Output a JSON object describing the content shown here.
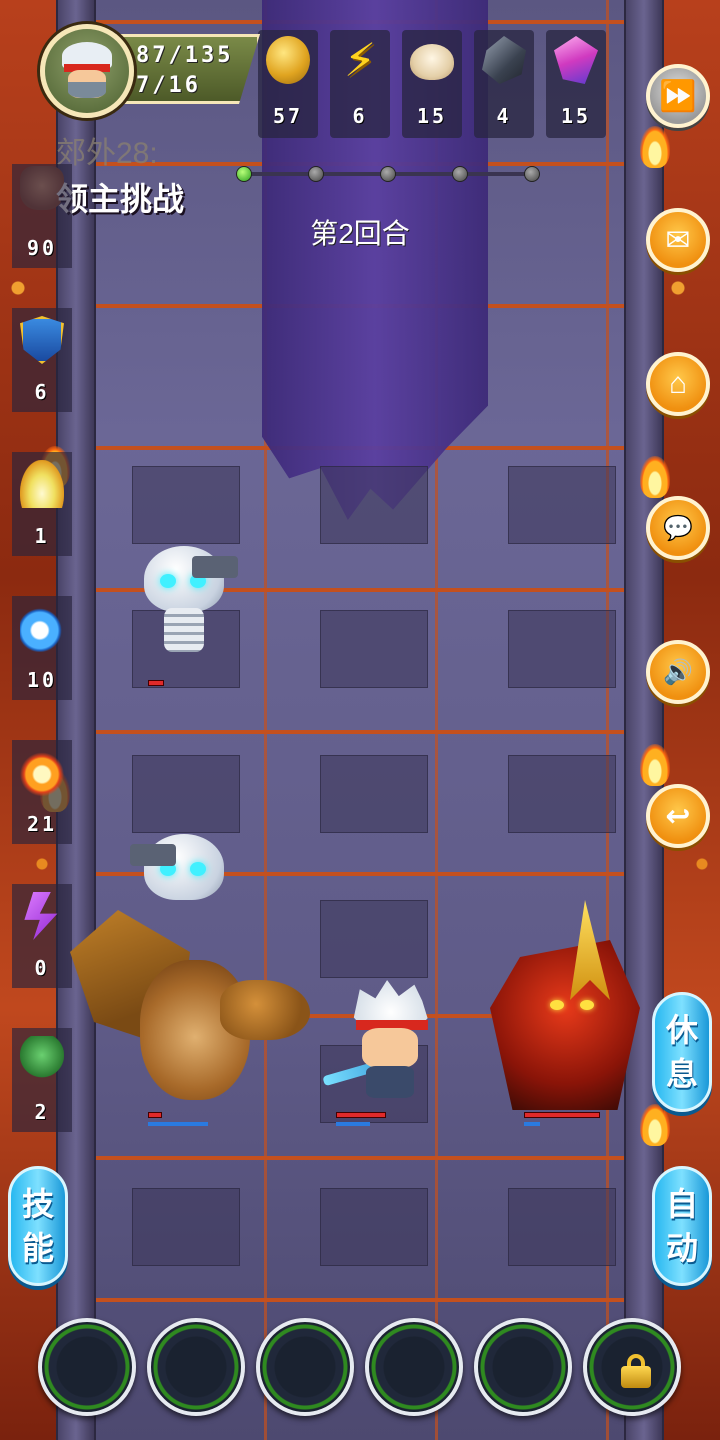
{
  "player": {
    "hp": "87/135",
    "level_progress": "7/16"
  },
  "resources": [
    {
      "icon": "coin-icon",
      "value": "57"
    },
    {
      "icon": "energy-bolt-icon",
      "value": "6"
    },
    {
      "icon": "bun-icon",
      "value": "15"
    },
    {
      "icon": "ore-icon",
      "value": "4"
    },
    {
      "icon": "crystal-icon",
      "value": "15"
    }
  ],
  "stage": {
    "label": "郊外28:",
    "title": "领主挑战",
    "round": "第2回合",
    "progress_total_steps": 5,
    "progress_current_step": 1
  },
  "skills_column": [
    {
      "icon": "fist-icon",
      "value": "90"
    },
    {
      "icon": "shield-icon",
      "value": "6"
    },
    {
      "icon": "holy-flame-icon",
      "value": "1"
    },
    {
      "icon": "water-swirl-icon",
      "value": "10"
    },
    {
      "icon": "fire-burst-icon",
      "value": "21"
    },
    {
      "icon": "lightning-rune-icon",
      "value": "0"
    },
    {
      "icon": "wind-icon",
      "value": "2"
    }
  ],
  "right_menu": [
    {
      "icon": "fast-forward-icon",
      "glyph": "⏩"
    },
    {
      "icon": "mail-icon",
      "glyph": "✉"
    },
    {
      "icon": "home-icon",
      "glyph": "⌂"
    },
    {
      "icon": "chat-icon",
      "glyph": "💬"
    },
    {
      "icon": "sound-icon",
      "glyph": "🔊"
    },
    {
      "icon": "return-icon",
      "glyph": "↩"
    }
  ],
  "buttons": {
    "rest": [
      "休",
      "息"
    ],
    "skills": [
      "技",
      "能"
    ],
    "auto": [
      "自",
      "动"
    ]
  },
  "bottom_slots": {
    "count": 6,
    "locked_last": true
  },
  "colors": {
    "accent_orange": "#f09010",
    "accent_blue": "#28b8f0",
    "hp_red": "#e02a2a",
    "mp_blue": "#2a7ae0"
  }
}
